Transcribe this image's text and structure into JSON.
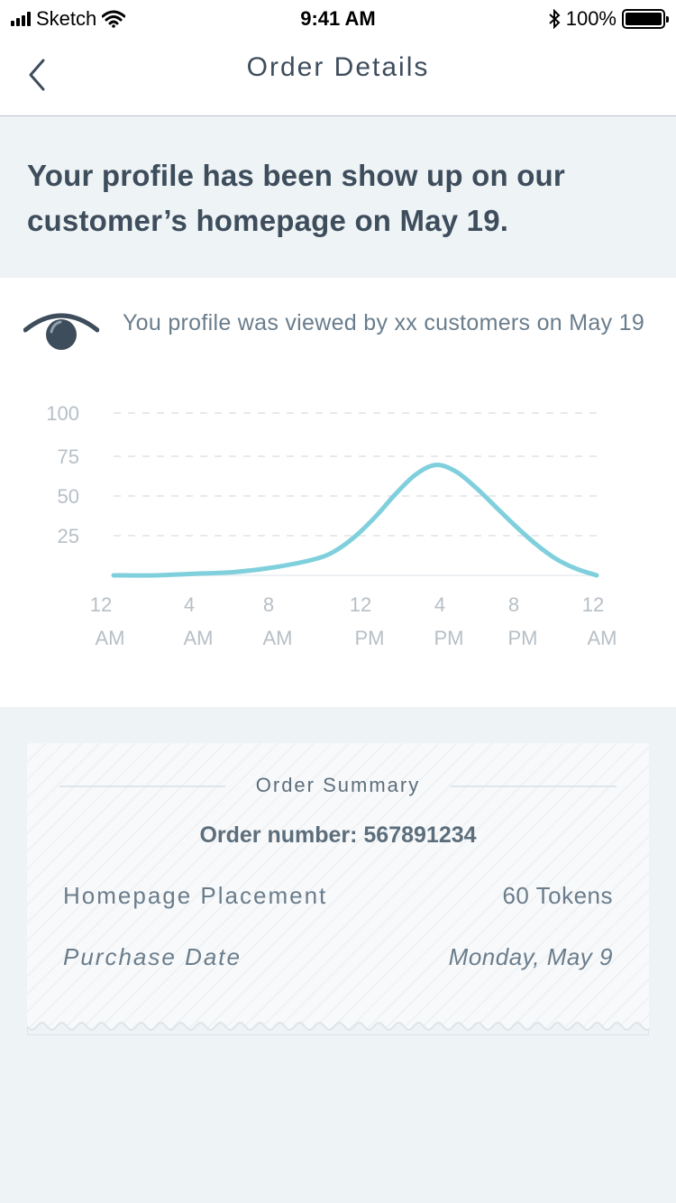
{
  "status_bar": {
    "carrier": "Sketch",
    "time": "9:41 AM",
    "battery": "100%",
    "battery_level": 1.0
  },
  "nav": {
    "title": "Order Details",
    "back_icon": "chevron-left-icon"
  },
  "notice": {
    "text": "Your profile has been show up on our customer’s homepage on May 19."
  },
  "views": {
    "icon": "eye-icon",
    "text": "You profile was viewed by xx customers on May 19"
  },
  "chart_data": {
    "type": "line",
    "y_ticks": [
      "100",
      "75",
      "50",
      "25"
    ],
    "ylim": [
      0,
      100
    ],
    "x_ticks": [
      {
        "top": "12",
        "bottom": "AM"
      },
      {
        "top": "4",
        "bottom": "AM"
      },
      {
        "top": "8",
        "bottom": "AM"
      },
      {
        "top": "12",
        "bottom": "PM"
      },
      {
        "top": "4",
        "bottom": "PM"
      },
      {
        "top": "8",
        "bottom": "PM"
      },
      {
        "top": "12",
        "bottom": "AM"
      }
    ],
    "x_hours": [
      0,
      4,
      8,
      12,
      16,
      20,
      24
    ],
    "series": [
      {
        "color": "#7fd0dc",
        "x": [
          0,
          2,
          4,
          6,
          8,
          10,
          11,
          12,
          13,
          14,
          15,
          16,
          17,
          18,
          19,
          20,
          21,
          22,
          23,
          24
        ],
        "values": [
          0,
          0,
          1,
          2,
          5,
          10,
          15,
          24,
          36,
          50,
          62,
          68,
          64,
          54,
          42,
          30,
          19,
          10,
          4,
          0
        ]
      }
    ],
    "grid": true,
    "grid_color": "#e6eaed"
  },
  "summary": {
    "title": "Order Summary",
    "order_number": "Order number: 567891234",
    "rows": [
      {
        "label": "Homepage Placement",
        "value": "60 Tokens"
      },
      {
        "label": "Purchase Date",
        "value": "Monday, May 9"
      }
    ]
  },
  "colors": {
    "text": "#3e4d5c",
    "muted": "#6a7d8c",
    "accent": "#7fd0dc",
    "background": "#eef3f6"
  }
}
